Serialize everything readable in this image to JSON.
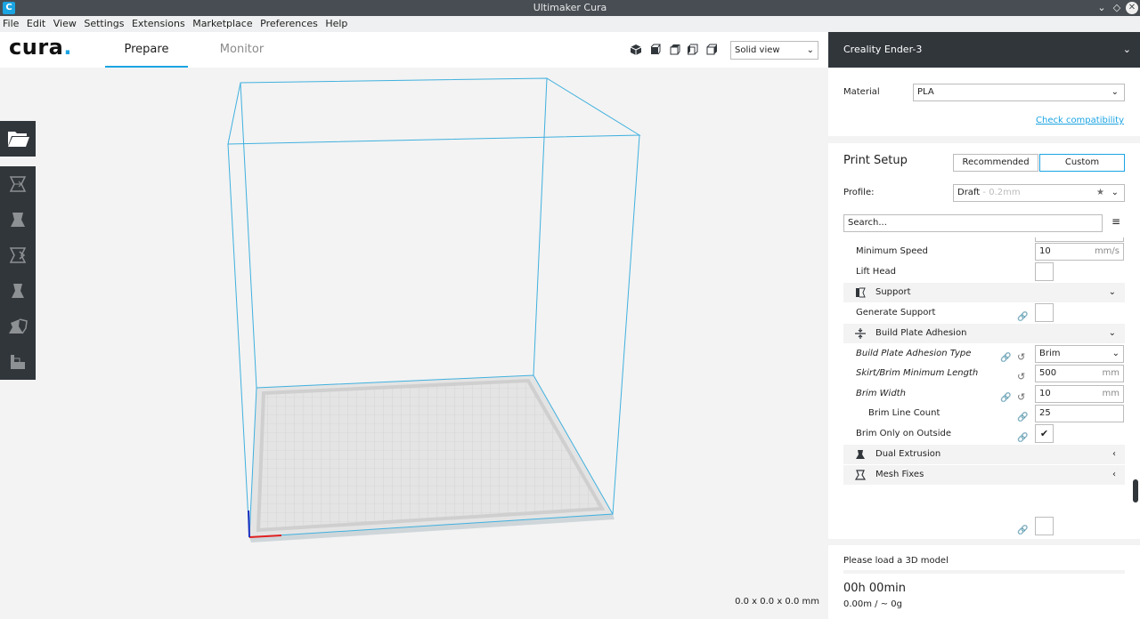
{
  "window": {
    "title": "Ultimaker Cura",
    "app_icon": "cura-app-icon"
  },
  "menu": [
    "File",
    "Edit",
    "View",
    "Settings",
    "Extensions",
    "Marketplace",
    "Preferences",
    "Help"
  ],
  "header": {
    "logo": "cura",
    "tabs": [
      "Prepare",
      "Monitor"
    ],
    "view_mode": "Solid view"
  },
  "viewport": {
    "dimensions": "0.0 x 0.0 x 0.0 mm"
  },
  "printer": {
    "name": "Creality Ender-3"
  },
  "material": {
    "label": "Material",
    "value": "PLA",
    "check_link": "Check compatibility"
  },
  "print_setup": {
    "title": "Print Setup",
    "modes": [
      "Recommended",
      "Custom"
    ],
    "profile_label": "Profile:",
    "profile_name": "Draft",
    "profile_detail": "- 0.2mm",
    "search_placeholder": "Search..."
  },
  "settings": {
    "minimum_speed": {
      "label": "Minimum Speed",
      "value": "10",
      "unit": "mm/s"
    },
    "lift_head": {
      "label": "Lift Head"
    },
    "support_cat": {
      "label": "Support"
    },
    "generate_support": {
      "label": "Generate Support"
    },
    "adhesion_cat": {
      "label": "Build Plate Adhesion"
    },
    "adhesion_type": {
      "label": "Build Plate Adhesion Type",
      "value": "Brim"
    },
    "skirt_min_length": {
      "label": "Skirt/Brim Minimum Length",
      "value": "500",
      "unit": "mm"
    },
    "brim_width": {
      "label": "Brim Width",
      "value": "10",
      "unit": "mm"
    },
    "brim_line_count": {
      "label": "Brim Line Count",
      "value": "25"
    },
    "brim_outside": {
      "label": "Brim Only on Outside",
      "checked": "✔"
    },
    "dual_extrusion_cat": {
      "label": "Dual Extrusion"
    },
    "mesh_fixes_cat": {
      "label": "Mesh Fixes"
    }
  },
  "job": {
    "message": "Please load a 3D model",
    "time": "00h 00min",
    "material": "0.00m / ~ 0g"
  },
  "colors": {
    "accent": "#1ba4e2",
    "dark": "#31363b"
  }
}
